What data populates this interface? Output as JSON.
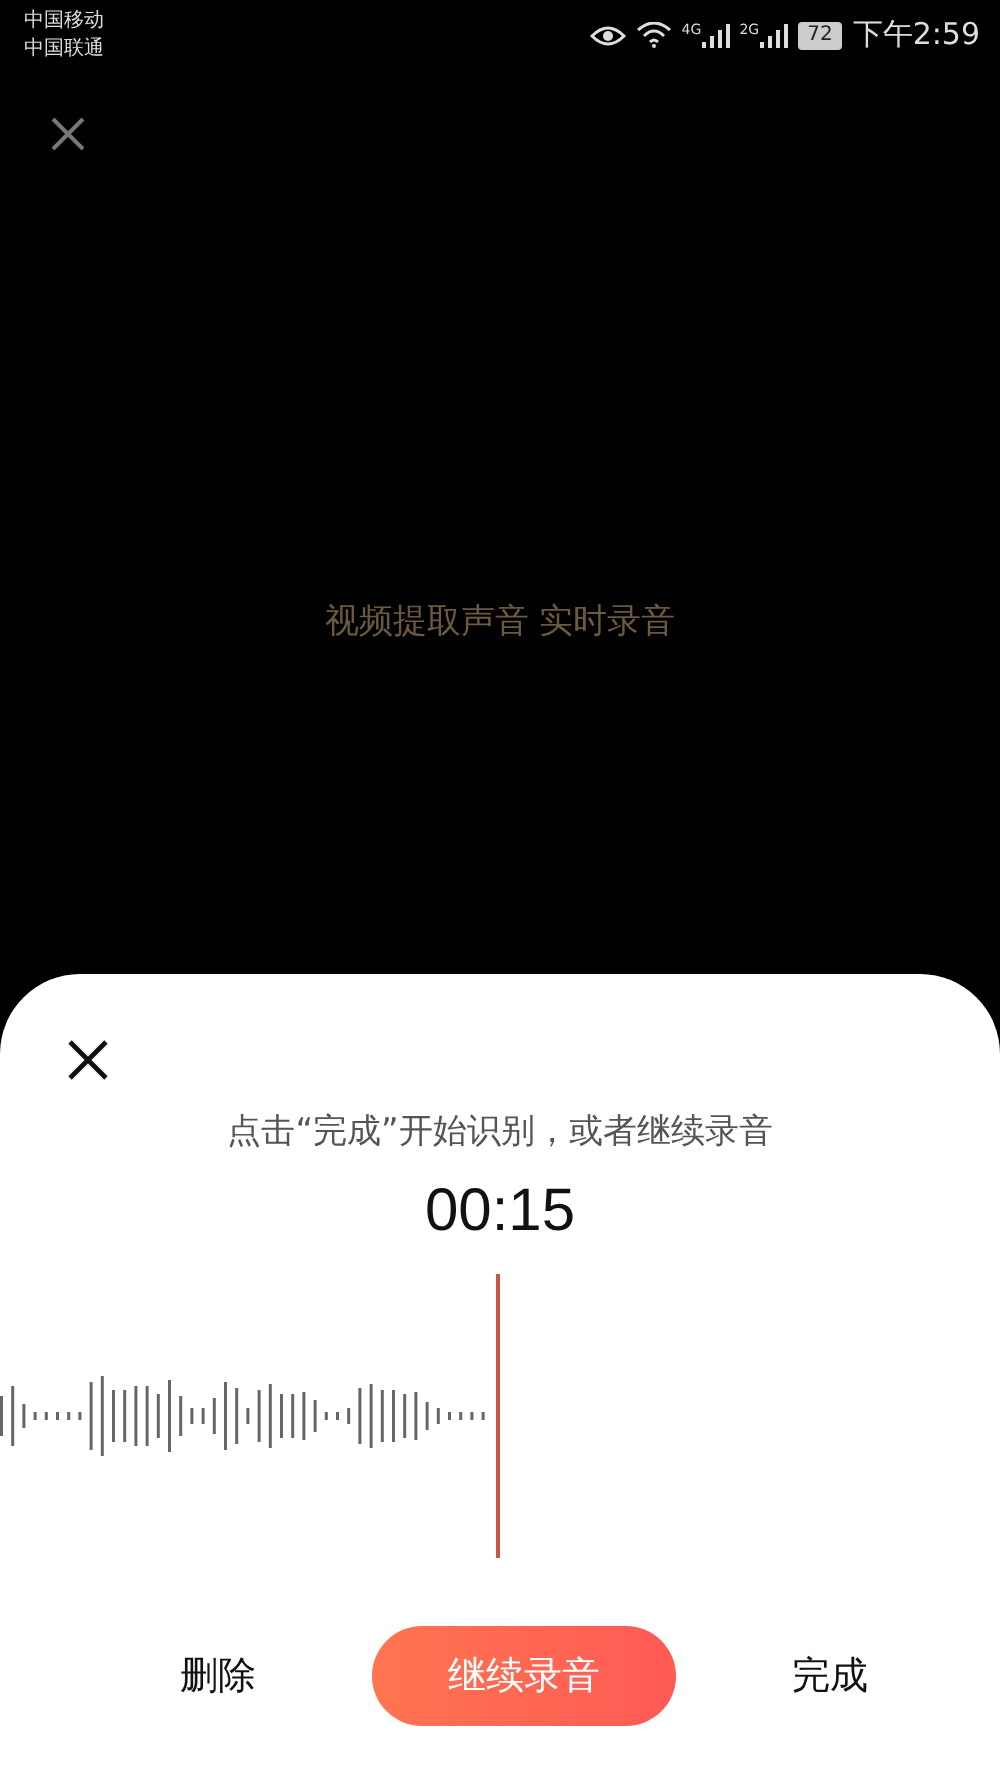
{
  "status_bar": {
    "carriers": [
      "中国移动",
      "中国联通"
    ],
    "network_1": "4G",
    "network_2": "2G",
    "battery": "72",
    "time": "下午2:59"
  },
  "background": {
    "caption": "视频提取声音 实时录音"
  },
  "recording_sheet": {
    "hint": "点击“完成”开始识别，或者继续录音",
    "timer": "00:15",
    "buttons": [
      {
        "kind": "text",
        "label": "删除"
      },
      {
        "kind": "primary",
        "label": "继续录音"
      },
      {
        "kind": "text",
        "label": "完成"
      }
    ]
  }
}
